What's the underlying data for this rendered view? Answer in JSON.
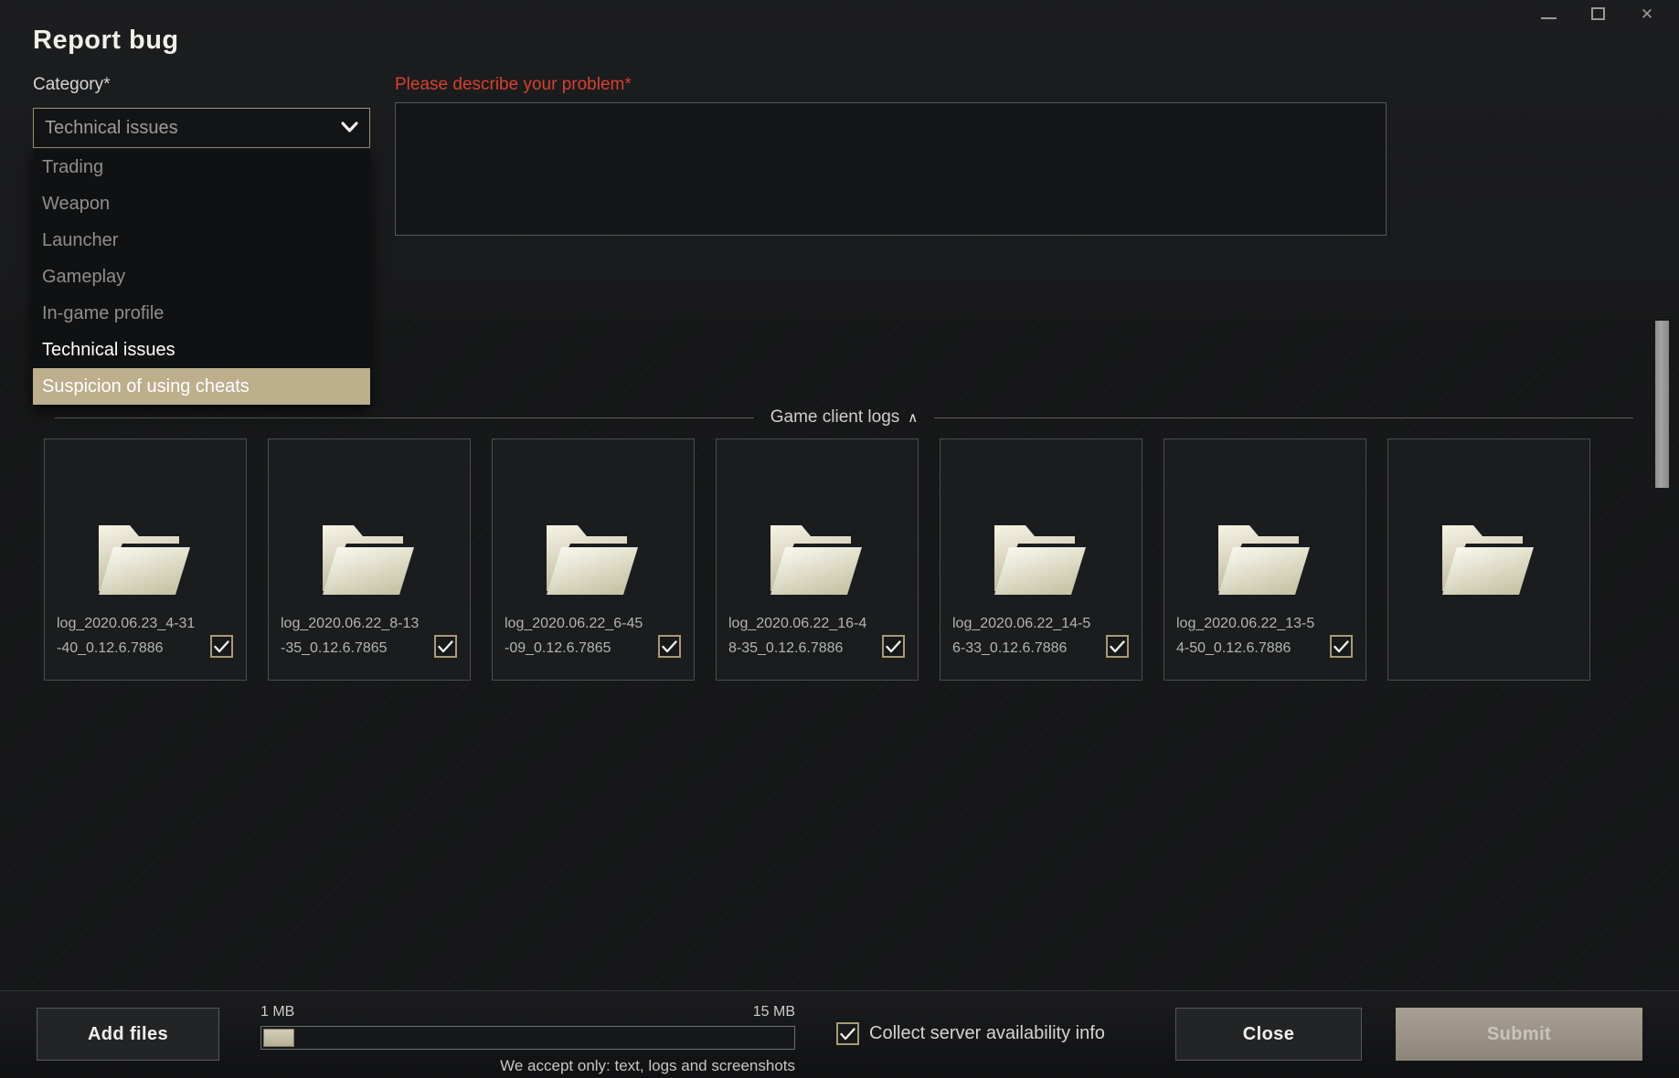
{
  "window": {
    "minimize_icon": "minimize-icon",
    "maximize_icon": "maximize-icon",
    "close_icon": "close-icon",
    "close_glyph": "✕"
  },
  "header": {
    "title": "Report bug"
  },
  "form": {
    "category_label": "Category*",
    "description_label": "Please describe your problem*",
    "description_value": "",
    "description_placeholder": "",
    "select": {
      "value": "Technical issues",
      "chevron_glyph": "❯",
      "options": [
        {
          "label": "Trading",
          "state": "normal"
        },
        {
          "label": "Weapon",
          "state": "normal"
        },
        {
          "label": "Launcher",
          "state": "normal"
        },
        {
          "label": "Gameplay",
          "state": "normal"
        },
        {
          "label": "In-game profile",
          "state": "normal"
        },
        {
          "label": "Technical issues",
          "state": "current"
        },
        {
          "label": "Suspicion of using cheats",
          "state": "highlighted"
        }
      ]
    }
  },
  "logs_section": {
    "title": "Game client logs",
    "collapse_glyph": "∧",
    "files": [
      {
        "name": "log_2020.06.23_4-31-40_0.12.6.7886",
        "checked": true
      },
      {
        "name": "log_2020.06.22_8-13-35_0.12.6.7865",
        "checked": true
      },
      {
        "name": "log_2020.06.22_6-45-09_0.12.6.7865",
        "checked": true
      },
      {
        "name": "log_2020.06.22_16-48-35_0.12.6.7886",
        "checked": true
      },
      {
        "name": "log_2020.06.22_14-56-33_0.12.6.7886",
        "checked": true
      },
      {
        "name": "log_2020.06.22_13-54-50_0.12.6.7886",
        "checked": true
      },
      {
        "name": "",
        "checked": false
      }
    ]
  },
  "footer": {
    "add_files_label": "Add files",
    "size_min_label": "1 MB",
    "size_max_label": "15 MB",
    "accept_note": "We accept only: text, logs and screenshots",
    "collect_label": "Collect server availability info",
    "collect_checked": true,
    "close_label": "Close",
    "submit_label": "Submit"
  },
  "colors": {
    "accent": "#bdae8c",
    "error": "#d8402c",
    "border": "#9c9178",
    "panel_bg": "#161718"
  }
}
